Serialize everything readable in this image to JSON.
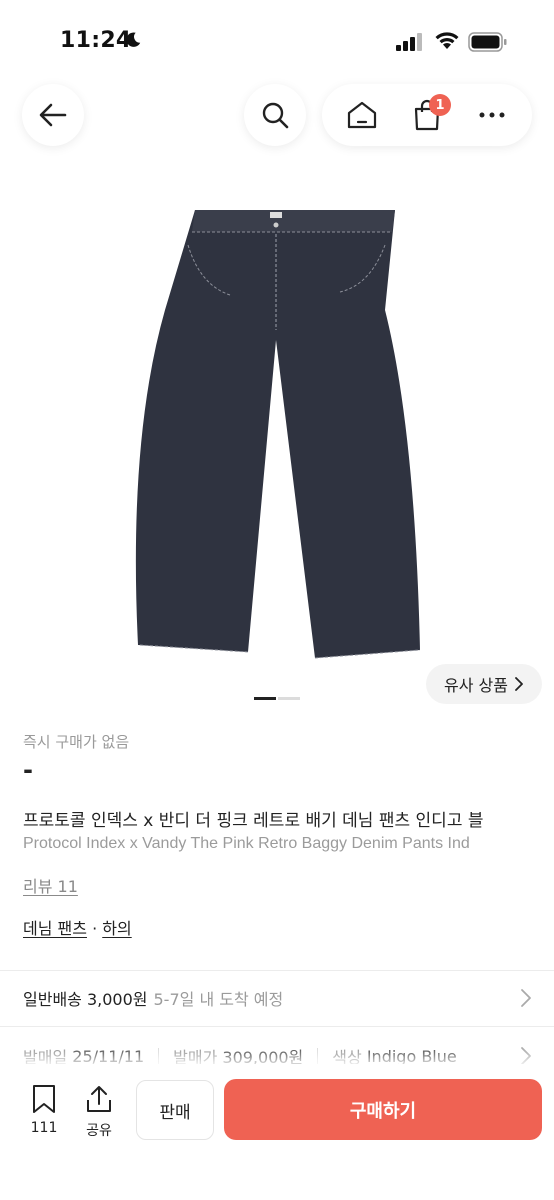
{
  "status_bar": {
    "time": "11:24"
  },
  "nav": {
    "cart_badge": "1"
  },
  "similar": {
    "label": "유사 상품"
  },
  "product": {
    "instant_label": "즉시 구매가 없음",
    "price": "-",
    "title_ko": "프로토콜 인덱스 x 반디 더 핑크 레트로 배기 데님 팬츠 인디고 블",
    "title_en": "Protocol Index x Vandy The Pink Retro Baggy Denim Pants Ind",
    "review": "리뷰 11",
    "category": {
      "main": "데님 팬츠",
      "sep": "·",
      "sub": "하의"
    }
  },
  "shipping": {
    "main": "일반배송 3,000원",
    "sub": "5-7일 내 도착 예정"
  },
  "meta": {
    "release_label": "발매일",
    "release_value": "25/11/11",
    "price_label": "발매가",
    "price_value": "309,000원",
    "color_label": "색상",
    "color_value": "Indigo Blue"
  },
  "bottom": {
    "bookmark_count": "111",
    "share_label": "공유",
    "sell_label": "판매",
    "buy_label": "구매하기"
  },
  "colors": {
    "accent": "#ef6253",
    "denim": "#2f3340"
  },
  "icons": [
    "moon-icon",
    "signal-icon",
    "wifi-icon",
    "battery-icon",
    "back-arrow-icon",
    "search-icon",
    "home-icon",
    "cart-icon",
    "more-icon",
    "chevron-right-icon",
    "bookmark-icon",
    "share-icon"
  ]
}
